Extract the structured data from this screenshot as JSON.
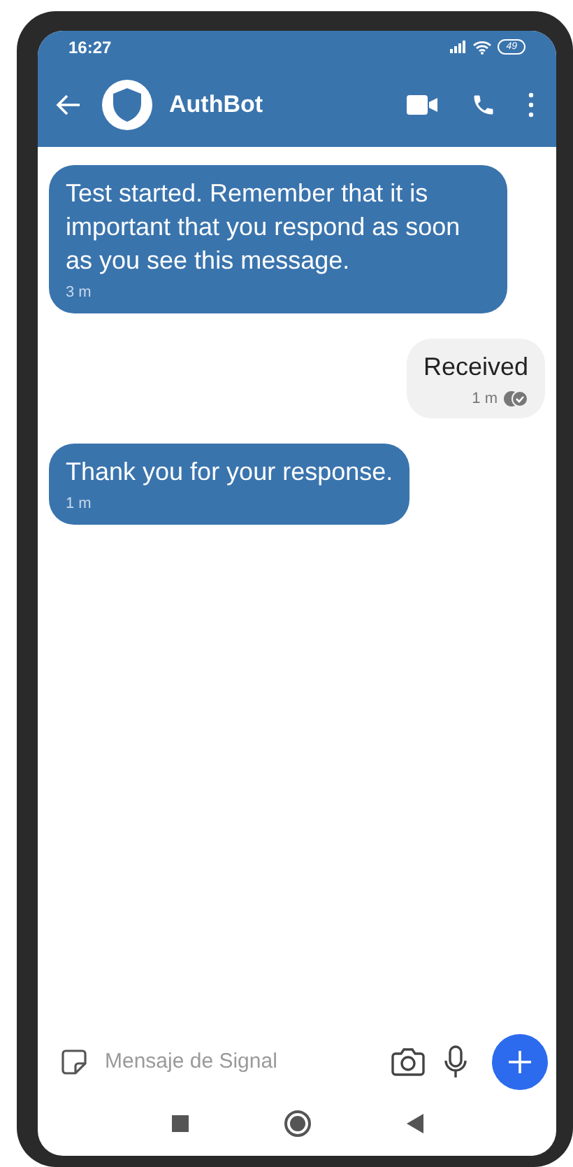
{
  "status_bar": {
    "time": "16:27",
    "battery": "49"
  },
  "header": {
    "title": "AuthBot"
  },
  "messages": [
    {
      "kind": "incoming",
      "text": "Test started. Remember that it is important that you respond as soon as you see this message.",
      "time": "3 m"
    },
    {
      "kind": "outgoing",
      "text": "Received",
      "time": "1 m",
      "read": true
    },
    {
      "kind": "incoming",
      "text": "Thank you for your response.",
      "time": "1 m"
    }
  ],
  "composer": {
    "placeholder": "Mensaje de Signal"
  }
}
